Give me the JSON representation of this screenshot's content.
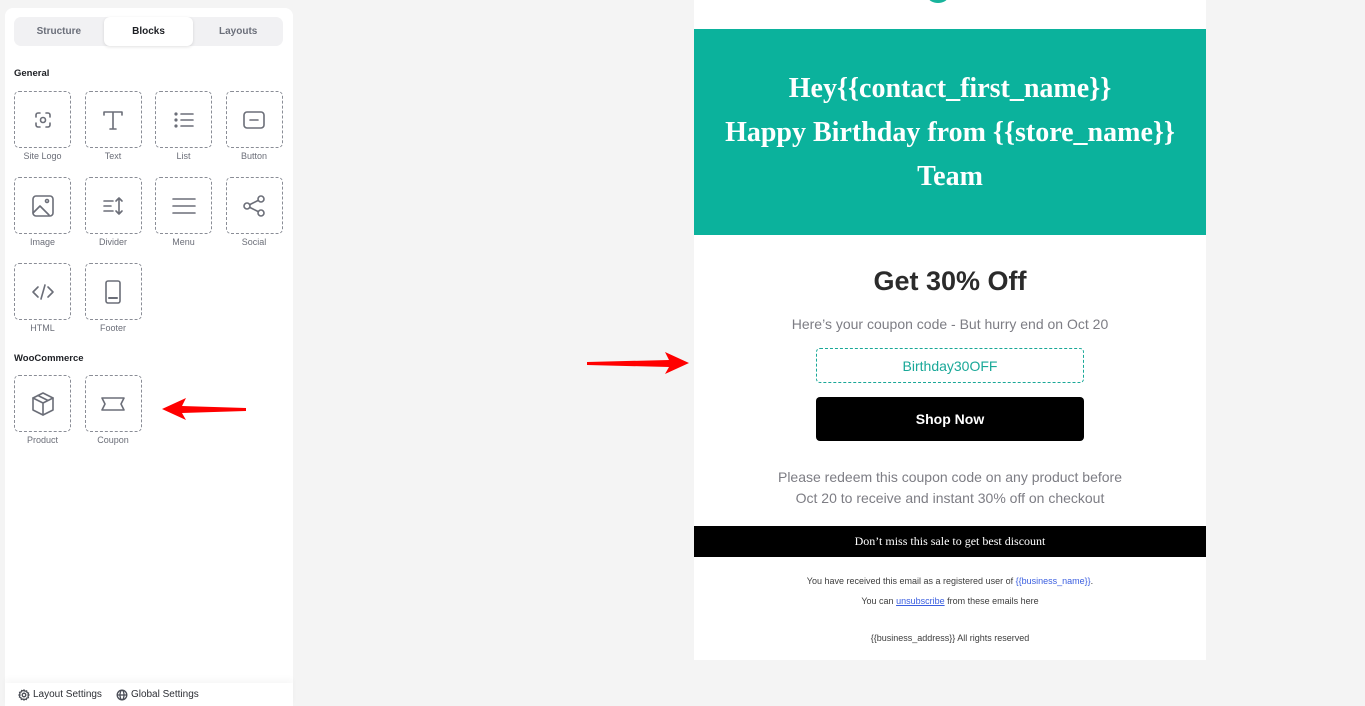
{
  "sidebar": {
    "tabs": [
      {
        "label": "Structure",
        "active": false
      },
      {
        "label": "Blocks",
        "active": true
      },
      {
        "label": "Layouts",
        "active": false
      }
    ],
    "general": {
      "title": "General",
      "blocks": [
        {
          "label": "Site Logo",
          "icon": "site-logo-icon"
        },
        {
          "label": "Text",
          "icon": "text-icon"
        },
        {
          "label": "List",
          "icon": "list-icon"
        },
        {
          "label": "Button",
          "icon": "button-icon"
        },
        {
          "label": "Image",
          "icon": "image-icon"
        },
        {
          "label": "Divider",
          "icon": "divider-icon"
        },
        {
          "label": "Menu",
          "icon": "menu-icon"
        },
        {
          "label": "Social",
          "icon": "share-icon"
        },
        {
          "label": "HTML",
          "icon": "code-icon"
        },
        {
          "label": "Footer",
          "icon": "footer-icon"
        }
      ]
    },
    "woocommerce": {
      "title": "WooCommerce",
      "blocks": [
        {
          "label": "Product",
          "icon": "box-icon"
        },
        {
          "label": "Coupon",
          "icon": "ticket-icon"
        }
      ]
    },
    "footer": {
      "layout_settings": "Layout Settings",
      "global_settings": "Global Settings"
    }
  },
  "email": {
    "hero": {
      "line1": "Hey{{contact_first_name}}",
      "line2": "Happy Birthday from {{store_name}}",
      "line3": "Team",
      "bg_color": "#0bb29c"
    },
    "offer_title": "Get 30% Off",
    "subtitle": "Here’s your coupon code - But hurry end on Oct 20",
    "coupon_code": "Birthday30OFF",
    "cta_label": "Shop Now",
    "redeem_line1": "Please redeem this coupon code on any product before",
    "redeem_line2": "Oct 20 to receive and instant 30% off on checkout",
    "banner_text": "Don’t miss this sale to get best discount",
    "legal": {
      "line1_prefix": "You have received this email as a registered user of ",
      "line1_var": "{{business_name}}",
      "line1_suffix": ".",
      "line2_prefix": "You can ",
      "line2_link": "unsubscribe",
      "line2_suffix": " from these emails here",
      "line3": "{{business_address}}  All rights reserved"
    }
  },
  "annotations": {
    "arrow_color": "#ff0000"
  }
}
